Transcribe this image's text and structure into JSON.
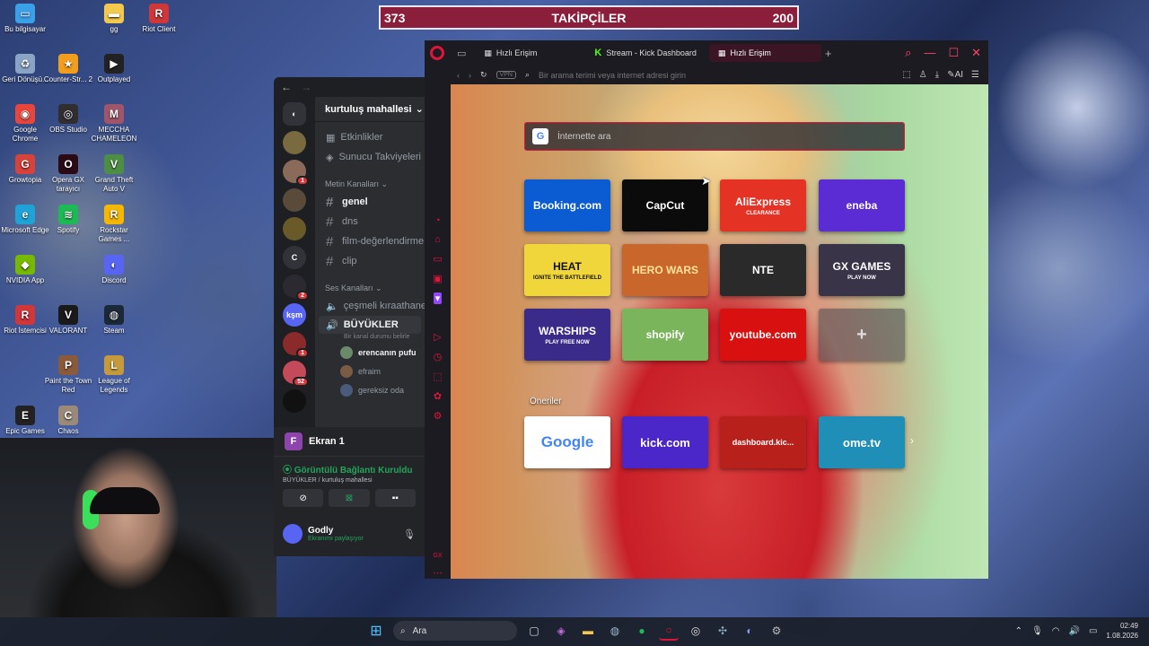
{
  "follower_bar": {
    "left_count": "373",
    "title": "TAKİPÇİLER",
    "right_count": "200"
  },
  "desktop": {
    "icons": [
      {
        "label": "Bu bilgisayar",
        "icon": "monitor-icon",
        "color": "#3aa0e8",
        "glyph": "▭"
      },
      {
        "label": "gg",
        "icon": "folder-icon",
        "color": "#f2c94c",
        "glyph": "▬"
      },
      {
        "label": "Riot Client",
        "icon": "riot-icon",
        "color": "#d13639",
        "glyph": "R"
      },
      {
        "label": "Geri Dönüşü...",
        "icon": "recycle-bin-icon",
        "color": "#8aa4c8",
        "glyph": "♻"
      },
      {
        "label": "Counter-Str... 2",
        "icon": "counter-strike-icon",
        "color": "#f29d1c",
        "glyph": "★"
      },
      {
        "label": "Outplayed",
        "icon": "outplayed-icon",
        "color": "#222222",
        "glyph": "▶"
      },
      {
        "label": "Google Chrome",
        "icon": "chrome-icon",
        "color": "#e8453c",
        "glyph": "◉"
      },
      {
        "label": "OBS Studio",
        "icon": "obs-icon",
        "color": "#302e31",
        "glyph": "◎"
      },
      {
        "label": "MECCHA CHAMELEON",
        "icon": "meccha-icon",
        "color": "#a0566a",
        "glyph": "M"
      },
      {
        "label": "Growtopia",
        "icon": "growtopia-icon",
        "color": "#d8423a",
        "glyph": "G"
      },
      {
        "label": "Opera GX tarayıcı",
        "icon": "opera-gx-icon",
        "color": "#2a0a14",
        "glyph": "O"
      },
      {
        "label": "Grand Theft Auto V",
        "icon": "gta-icon",
        "color": "#4d8e44",
        "glyph": "V"
      },
      {
        "label": "Microsoft Edge",
        "icon": "edge-icon",
        "color": "#1fa3d6",
        "glyph": "e"
      },
      {
        "label": "Spotify",
        "icon": "spotify-icon",
        "color": "#1db954",
        "glyph": "≋"
      },
      {
        "label": "Rockstar Games ...",
        "icon": "rockstar-icon",
        "color": "#f5b700",
        "glyph": "R"
      },
      {
        "label": "NVIDIA App",
        "icon": "nvidia-icon",
        "color": "#76b900",
        "glyph": "◆"
      },
      {
        "label": "Discord",
        "icon": "discord-icon",
        "color": "#5865f2",
        "glyph": "◐"
      },
      {
        "label": "Riot İstemcisi",
        "icon": "riot-client-icon",
        "color": "#d13639",
        "glyph": "R"
      },
      {
        "label": "VALORANT",
        "icon": "valorant-icon",
        "color": "#1a1a1a",
        "glyph": "V"
      },
      {
        "label": "Steam",
        "icon": "steam-icon",
        "color": "#1b2838",
        "glyph": "◍"
      },
      {
        "label": "Paint the Town Red",
        "icon": "paint-town-red-icon",
        "color": "#8a5a3a",
        "glyph": "P"
      },
      {
        "label": "League of Legends",
        "icon": "league-icon",
        "color": "#c49a3c",
        "glyph": "L"
      },
      {
        "label": "Epic Games",
        "icon": "epic-games-icon",
        "color": "#222222",
        "glyph": "E"
      },
      {
        "label": "Chaos",
        "icon": "chaos-icon",
        "color": "#9b8a7a",
        "glyph": "C"
      }
    ]
  },
  "discord": {
    "server_name": "kurtuluş mahallesi",
    "menu": [
      "Etkinlikler",
      "Sunucu Takviyeleri"
    ],
    "text_category": "Metin Kanalları",
    "text_channels": [
      "genel",
      "dns",
      "film-değerlendirme",
      "clip"
    ],
    "voice_category": "Ses Kanalları",
    "voice_channels": [
      "çeşmeli kıraathanesi",
      "BÜYÜKLER"
    ],
    "voice_status_hint": "Bir kanal durumu belirle",
    "voice_users": [
      "erencanın pufu",
      "efraim",
      "gereksiz oda"
    ],
    "guild_c_label": "C",
    "guild_ksm_label": "kşm",
    "badges": [
      "1",
      "2",
      "1",
      "52"
    ],
    "screen_label": "Ekran 1",
    "screen_letter": "F",
    "connection_status": "Görüntülü Bağlantı Kuruldu",
    "connection_sub": "BÜYÜKLER / kurtuluş mahallesi",
    "user_name": "Godly",
    "user_status": "Ekranımı paylaşıyor"
  },
  "browser": {
    "tabs": [
      {
        "label": "Hızlı Erişim",
        "icon": "speed-dial-icon"
      },
      {
        "label": "Stream - Kick Dashboard",
        "icon": "kick-icon"
      },
      {
        "label": "Hızlı Erişim",
        "icon": "speed-dial-icon"
      }
    ],
    "new_tab_label": "+",
    "vpn_label": "VPN",
    "address_placeholder": "Bir arama terimi veya internet adresi girin",
    "ai_label": "AI",
    "search_placeholder": "İnternette ara",
    "speed_dials": [
      {
        "label": "Booking.com",
        "bg": "#0b5bd3",
        "color": "#ffffff",
        "sub": ""
      },
      {
        "label": "CapCut",
        "bg": "#0b0b0b",
        "color": "#ffffff",
        "sub": ""
      },
      {
        "label": "AliExpress",
        "bg": "#e43225",
        "color": "#ffffff",
        "sub": "CLEARANCE"
      },
      {
        "label": "eneba",
        "bg": "#5b2bd4",
        "color": "#ffffff",
        "sub": ""
      },
      {
        "label": "HEAT",
        "bg": "#f1d63b",
        "color": "#111111",
        "sub": "IGNITE THE BATTLEFIELD"
      },
      {
        "label": "HERO WARS",
        "bg": "#c9662c",
        "color": "#ffe39a",
        "sub": ""
      },
      {
        "label": "NTE",
        "bg": "#2a2a2a",
        "color": "#ffffff",
        "sub": ""
      },
      {
        "label": "GX GAMES",
        "bg": "#3a3448",
        "color": "#ffffff",
        "sub": "PLAY NOW"
      },
      {
        "label": "WARSHIPS",
        "bg": "#3a2b8a",
        "color": "#ffffff",
        "sub": "PLAY FREE NOW"
      },
      {
        "label": "shopify",
        "bg": "#7ab55c",
        "color": "#ffffff",
        "sub": ""
      },
      {
        "label": "youtube.com",
        "bg": "#d81010",
        "color": "#ffffff",
        "sub": ""
      },
      {
        "label": "+",
        "bg": "rgba(70,70,80,0.55)",
        "color": "#dddddd",
        "sub": ""
      }
    ],
    "suggestions_label": "Öneriler",
    "suggestions": [
      {
        "label": "Google",
        "bg": "#ffffff",
        "color": "#4285f4"
      },
      {
        "label": "kick.com",
        "bg": "#4b27c9",
        "color": "#ffffff"
      },
      {
        "label": "dashboard.kic...",
        "bg": "#b8201c",
        "color": "#ffffff"
      },
      {
        "label": "ome.tv",
        "bg": "#1f8fb8",
        "color": "#ffffff"
      }
    ]
  },
  "taskbar": {
    "search_label": "Ara",
    "time": "02:49",
    "date": "1.08.2026"
  },
  "colors": {
    "opera_red": "#e0153a",
    "discord_green": "#23a55a",
    "follower_bar_bg": "#8b1f3b"
  }
}
